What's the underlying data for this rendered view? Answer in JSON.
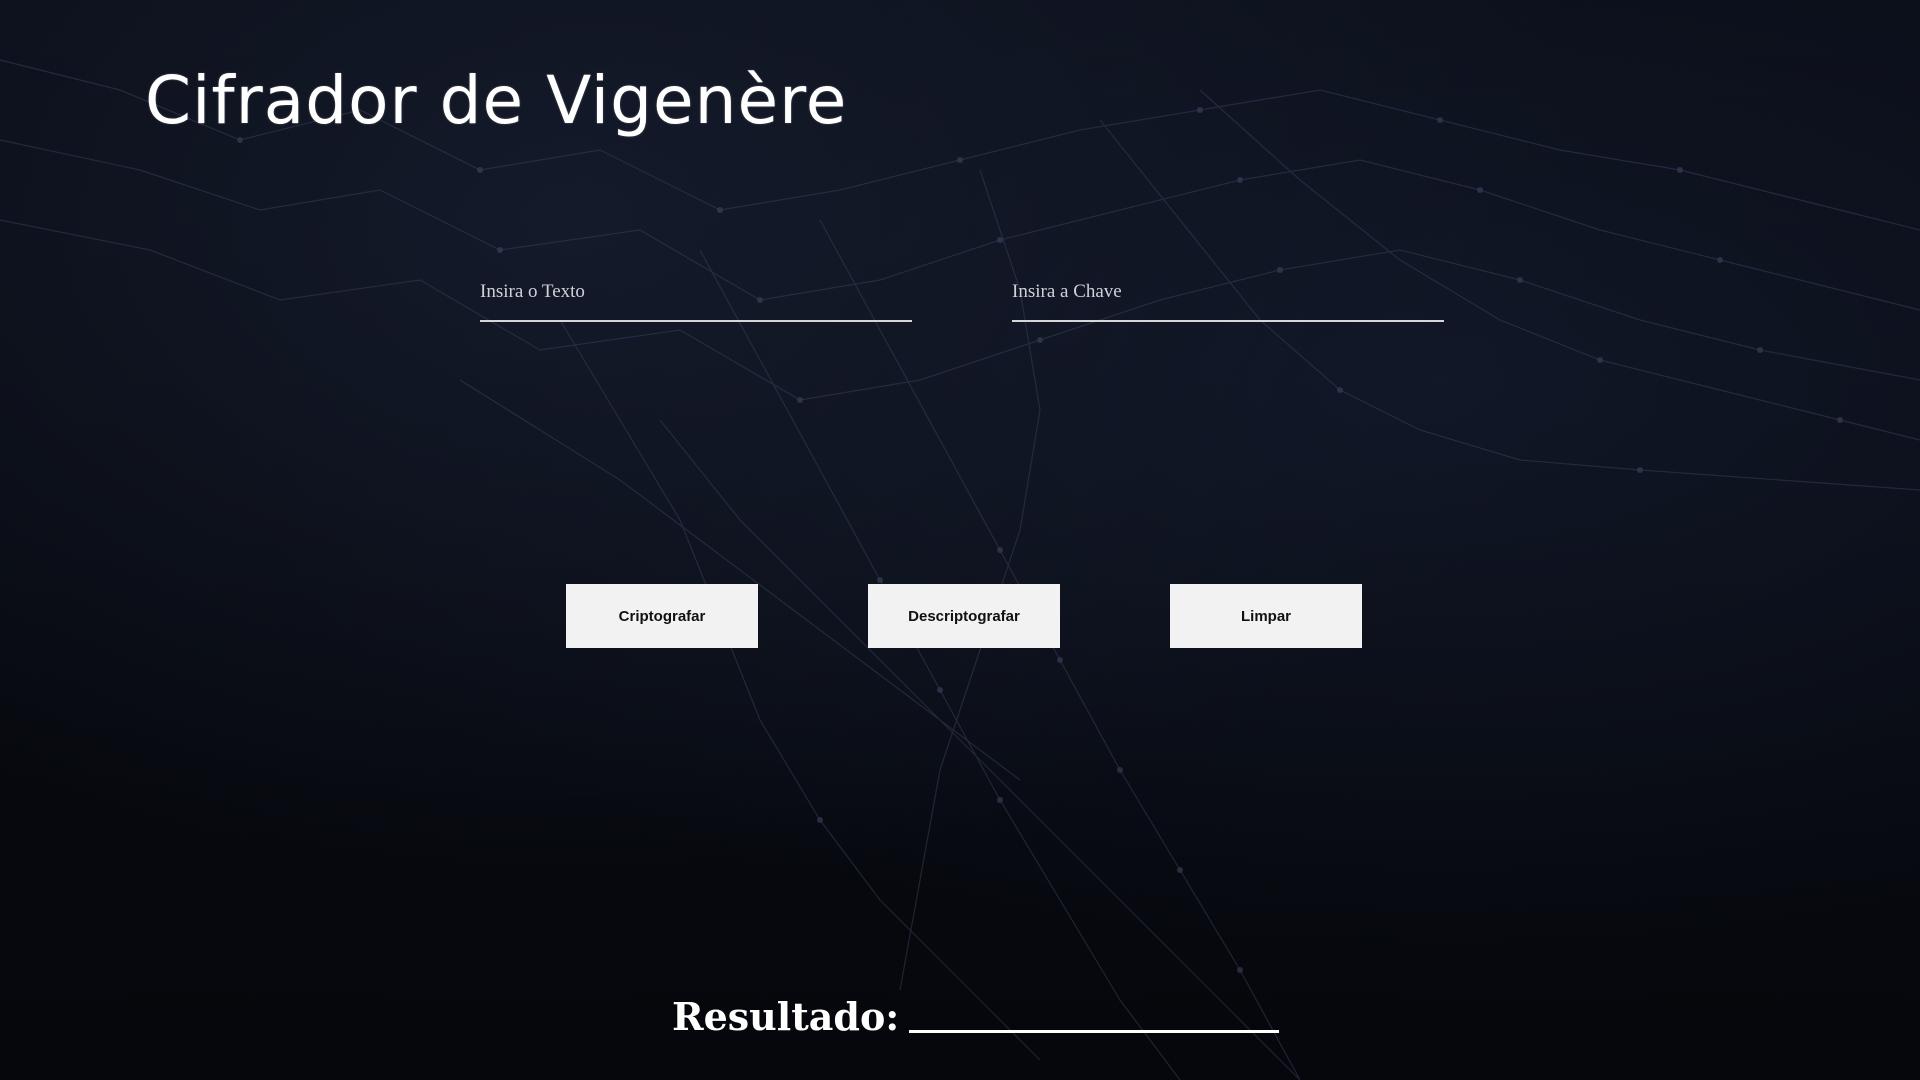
{
  "page": {
    "title": "Cifrador de Vigenère"
  },
  "inputs": {
    "texto_placeholder": "Insira o Texto",
    "texto_value": "",
    "chave_placeholder": "Insira a Chave",
    "chave_value": ""
  },
  "buttons": {
    "encrypt_label": "Criptografar",
    "decrypt_label": "Descriptografar",
    "clear_label": "Limpar"
  },
  "result": {
    "label": "Resultado:",
    "value": ""
  },
  "colors": {
    "background": "#07090f",
    "text": "#ffffff",
    "button_bg": "#f2f2f2",
    "network_line": "#3b4560"
  }
}
